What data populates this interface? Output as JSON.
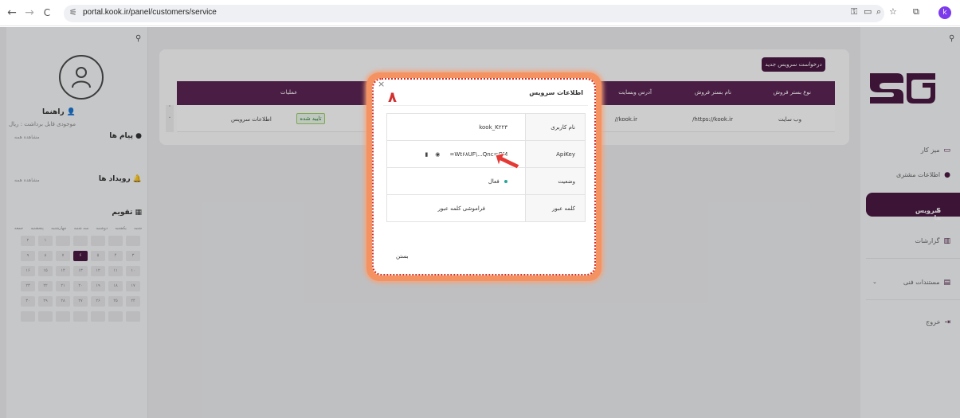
{
  "browser": {
    "url": "portal.kook.ir/panel/customers/service",
    "back_icon": "←",
    "forward_icon": "→",
    "reload_icon": "C",
    "profile_letter": "k"
  },
  "left_panel": {
    "user_name": "راهنما",
    "balance": "موجودی قابل برداشت : ریال",
    "messages_label": "پیام ها",
    "messages_more": "مشاهده همه",
    "events_label": "رویداد ها",
    "events_more": "مشاهده همه",
    "calendar_label": "تقویم",
    "calendar_weekdays": [
      "شنبه",
      "یکشنبه",
      "دوشنبه",
      "سه شنبه",
      "چهارشنبه",
      "پنجشنبه",
      "جمعه"
    ],
    "calendar_days": [
      "",
      "",
      "",
      "",
      "",
      "۱",
      "۲",
      "۳",
      "۴",
      "۵",
      "۶",
      "۷",
      "۸",
      "۹",
      "۱۰",
      "۱۱",
      "۱۲",
      "۱۳",
      "۱۴",
      "۱۵",
      "۱۶",
      "۱۷",
      "۱۸",
      "۱۹",
      "۲۰",
      "۲۱",
      "۲۲",
      "۲۳",
      "۲۴",
      "۲۵",
      "۲۶",
      "۲۷",
      "۲۸",
      "۲۹",
      "۳۰",
      "",
      "",
      "",
      "",
      "",
      "",
      ""
    ],
    "today": "۶"
  },
  "main": {
    "new_service_button": "درخواست سرویس جدید",
    "columns": [
      "نوع بستر فروش",
      "نام بستر فروش",
      "آدرس وبسایت",
      "عملیات"
    ],
    "row": {
      "type": "وب سایت",
      "name": "/https://kook.ir",
      "address": "//kook.ir",
      "status": "تایید شده",
      "info_link": "اطلاعات سرویس"
    }
  },
  "right_sidebar": {
    "items": [
      "میز کار",
      "اطلاعات مشتری",
      "سرویس ها",
      "گزارشات",
      "مستندات فنی",
      "خروج"
    ],
    "active": "سرویس ها"
  },
  "modal": {
    "title": "اطلاعات سرویس",
    "step_number": "۸",
    "rows": [
      {
        "key": "نام کاربری",
        "value": "kook_K۲۲۳"
      },
      {
        "key": "ApiKey",
        "value": "=Wt۶۸UF\\...Qnc=QM"
      },
      {
        "key": "وضعیت",
        "value": "فعال"
      },
      {
        "key": "کلمه عبور",
        "value": "فراموشی کلمه عبور"
      }
    ],
    "close_label": "بستن",
    "close_icon": "×"
  },
  "colors": {
    "brand": "#4a1942",
    "table_header": "#5b2453",
    "highlight_border": "#d72a1f",
    "highlight_glow": "#f59262",
    "arrow": "#e53935"
  }
}
